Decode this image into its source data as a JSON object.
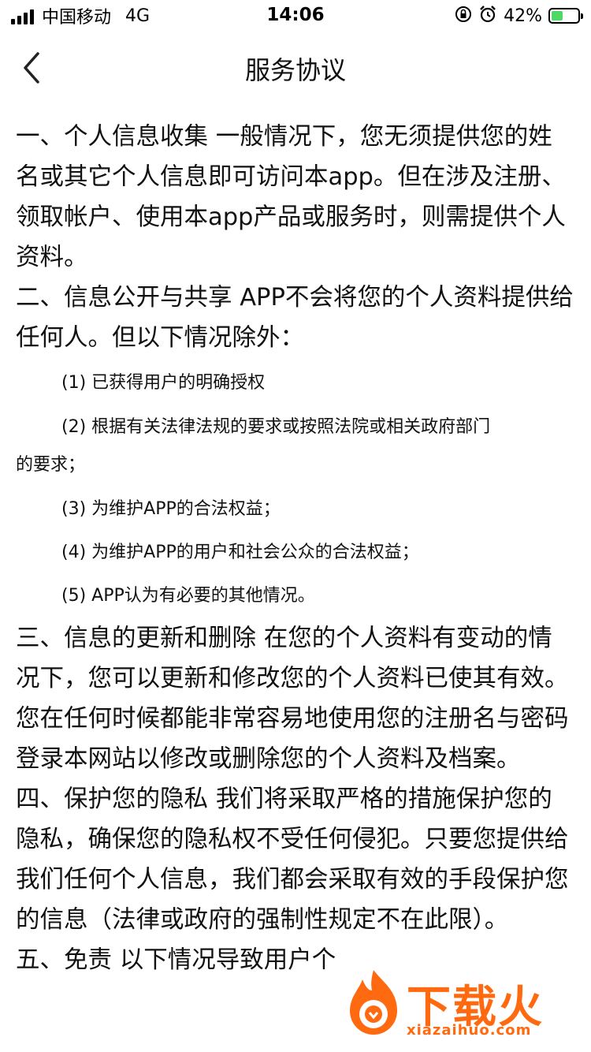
{
  "status_bar": {
    "carrier": "中国移动",
    "network": "4G",
    "time": "14:06",
    "battery": "42%",
    "battery_color": "#4cd964"
  },
  "nav": {
    "title": "服务协议",
    "back_icon": "chevron-left-icon"
  },
  "content": {
    "paragraphs": [
      "一、个人信息收集 一般情况下，您无须提供您的姓名或其它个人信息即可访问本app。但在涉及注册、领取帐户、使用本app产品或服务时，则需提供个人资料。",
      "二、信息公开与共享 APP不会将您的个人资料提供给任何人。但以下情况除外：",
      "(1) 已获得用户的明确授权",
      "(2) 根据有关法律法规的要求或按照法院或相关政府部门",
      "的要求；",
      "(3) 为维护APP的合法权益；",
      "(4) 为维护APP的用户和社会公众的合法权益；",
      "(5) APP认为有必要的其他情况。",
      "三、信息的更新和删除 在您的个人资料有变动的情况下，您可以更新和修改您的个人资料已使其有效。您在任何时候都能非常容易地使用您的注册名与密码登录本网站以修改或删除您的个人资料及档案。",
      "四、保护您的隐私 我们将采取严格的措施保护您的隐私，确保您的隐私权不受任何侵犯。只要您提供给我们任何个人信息，我们都会采取有效的手段保护您的信息（法律或政府的强制性规定不在此限）。",
      "五、免责 以下情况导致用户个"
    ]
  },
  "watermark": {
    "brand": "下载火",
    "url": "xiazaihuo.com",
    "color": "#ff6a10"
  }
}
